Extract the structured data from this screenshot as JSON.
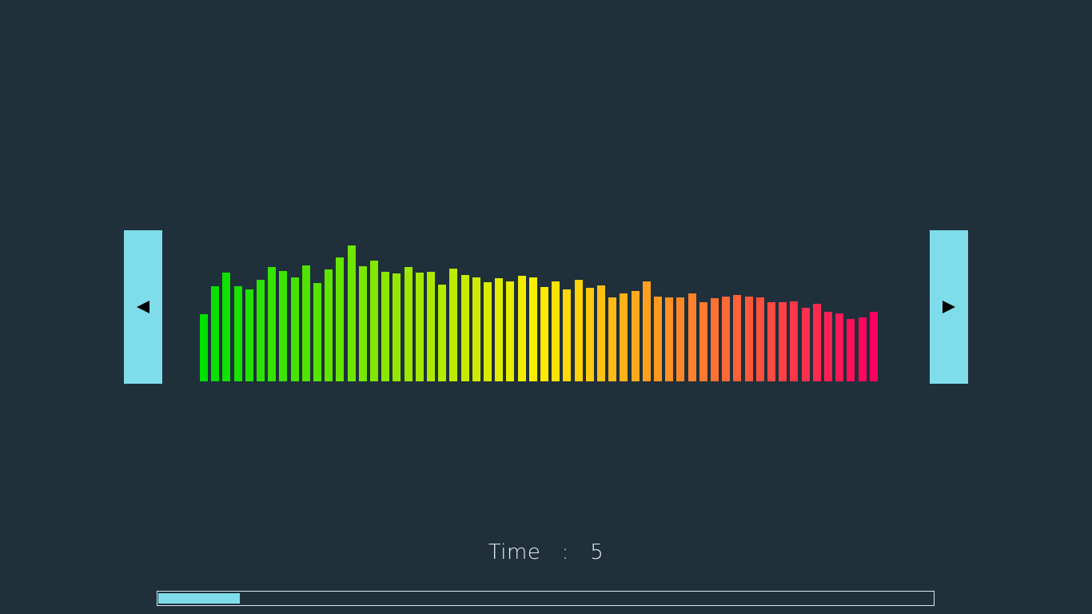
{
  "nav": {
    "prev_icon": "left-triangle-icon",
    "next_icon": "right-triangle-icon",
    "button_color": "#7fdcea"
  },
  "time": {
    "label": "Time",
    "separator": ":",
    "value": "5"
  },
  "progress": {
    "fraction": 0.105,
    "color": "#7fdcea"
  },
  "chart_data": {
    "type": "bar",
    "title": "",
    "xlabel": "",
    "ylabel": "",
    "ylim": [
      0,
      170
    ],
    "colors": {
      "start": "#00e000",
      "mid": "#ffee00",
      "end": "#ff0060"
    },
    "values": [
      81,
      114,
      131,
      114,
      110,
      122,
      137,
      133,
      125,
      139,
      118,
      134,
      149,
      163,
      138,
      145,
      132,
      130,
      137,
      131,
      132,
      116,
      135,
      128,
      125,
      119,
      124,
      120,
      127,
      125,
      113,
      120,
      110,
      122,
      112,
      115,
      101,
      106,
      109,
      120,
      102,
      101,
      101,
      106,
      95,
      100,
      102,
      104,
      102,
      101,
      95,
      95,
      96,
      88,
      93,
      84,
      82,
      75,
      77,
      84
    ]
  }
}
